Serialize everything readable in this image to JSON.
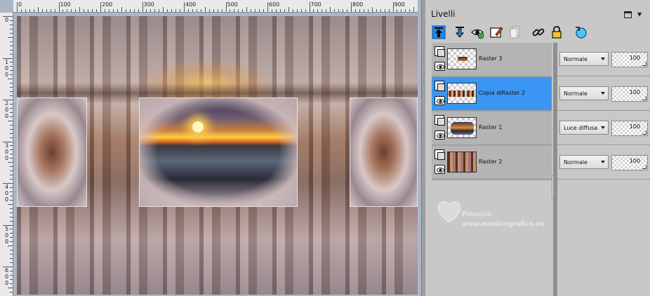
{
  "ruler": {
    "top_labels": [
      "0",
      "100",
      "200",
      "300",
      "400",
      "500",
      "600",
      "700",
      "800",
      "900"
    ],
    "left_labels": [
      "0",
      "100",
      "200",
      "300",
      "400",
      "500",
      "600"
    ]
  },
  "panel": {
    "title": "Livelli",
    "toolbar_icons": [
      "new-layer-up-icon",
      "new-layer-down-icon",
      "visibility-toggle-icon",
      "edit-layer-icon",
      "copy-layer-icon",
      "link-icon",
      "lock-icon",
      "refresh-icon"
    ]
  },
  "layers": [
    {
      "name": "Raster 3",
      "blend_mode": "Normale",
      "opacity": "100",
      "selected": false
    },
    {
      "name": "Copia diRaster 2",
      "blend_mode": "Normale",
      "opacity": "100",
      "selected": true
    },
    {
      "name": "Raster 1",
      "blend_mode": "Luce diffusa",
      "opacity": "100",
      "selected": false
    },
    {
      "name": "Raster 2",
      "blend_mode": "Normale",
      "opacity": "100",
      "selected": false
    }
  ],
  "watermark": {
    "name": "Pinuccia",
    "url": "www.maldiregrafica.eu"
  },
  "colors": {
    "selection": "#3a96f2",
    "panel_bg": "#c8c8c8"
  }
}
